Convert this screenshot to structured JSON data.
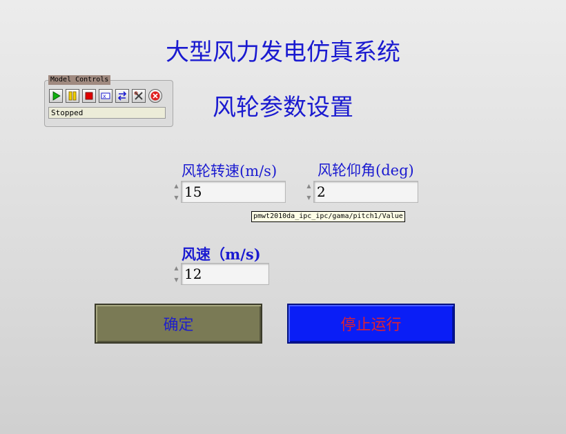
{
  "app_title": "大型风力发电仿真系统",
  "page_title": "风轮参数设置",
  "model_controls": {
    "label": "Model Controls",
    "buttons": [
      {
        "icon": "play-icon",
        "color": "#10b010"
      },
      {
        "icon": "pause-icon",
        "color": "#f0d000"
      },
      {
        "icon": "stop-icon",
        "color": "#e00000"
      },
      {
        "icon": "step-icon",
        "color": "#1a1ad0"
      },
      {
        "icon": "connect-icon",
        "color": "#1a1ad0"
      },
      {
        "icon": "tools-icon",
        "color": "#404040"
      },
      {
        "icon": "close-icon",
        "color": "#e02020"
      }
    ],
    "status": "Stopped"
  },
  "rotor_speed": {
    "label": "风轮转速(m/s)",
    "value": "15"
  },
  "pitch_angle": {
    "label": "风轮仰角(deg)",
    "value": "2"
  },
  "tooltip": "pmwt2010da_ipc_ipc/gama/pitch1/Value",
  "wind_speed": {
    "label": "风速（m/s)",
    "value": "12"
  },
  "buttons": {
    "confirm": "确定",
    "stop": "停止运行"
  },
  "colors": {
    "title": "#1a1ad0",
    "confirm_bg": "#7a7a55",
    "stop_bg": "#0a1ef6",
    "stop_text": "#e02030"
  }
}
